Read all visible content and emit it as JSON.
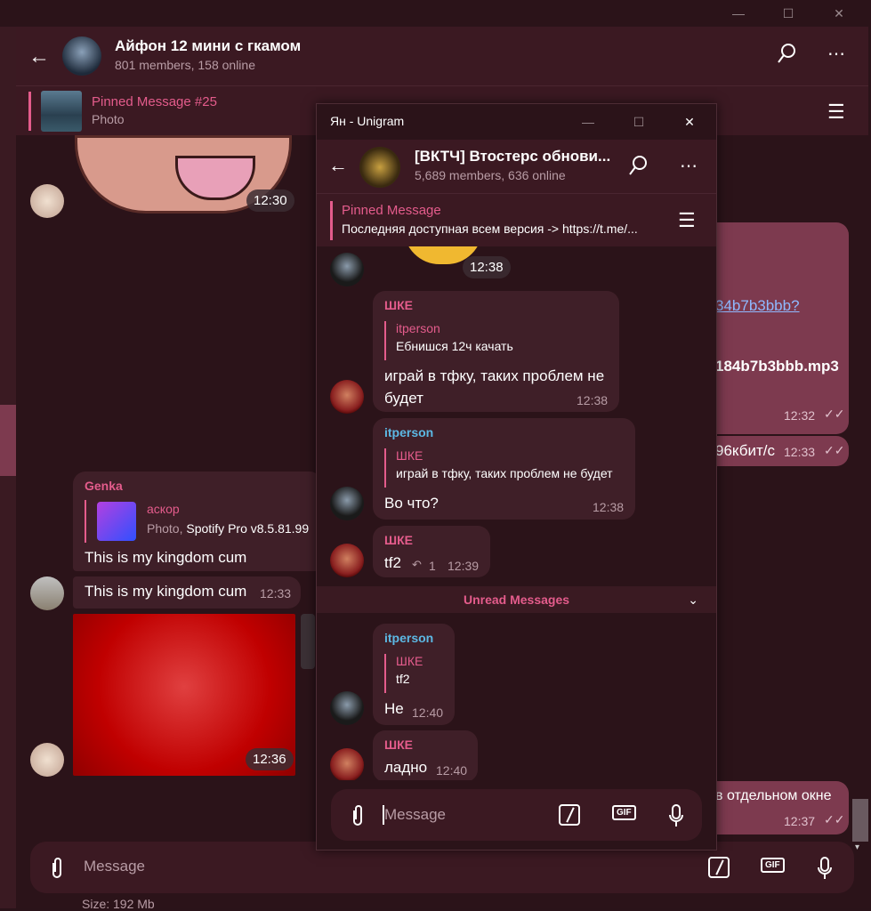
{
  "main": {
    "header": {
      "title": "Айфон 12 мини с гкамом",
      "subtitle": "801 members, 158 online"
    },
    "pinned": {
      "title": "Pinned Message #25",
      "subtitle": "Photo"
    },
    "messages": {
      "sticker_time": "12:30",
      "own1_link": "34b7b3bbb?",
      "own1_file": "184b7b3bbb.mp3",
      "own1_time": "12:32",
      "own2_text": "96кбит/с",
      "own2_time": "12:33",
      "genka_name": "Genka",
      "genka_reply_name": "аскор",
      "genka_reply_prefix": "Photo,",
      "genka_reply_text": "Spotify Pro  v8.5.81.99",
      "genka_text": "This is my kingdom cum",
      "genka2_text": "This is my kingdom cum",
      "genka2_time": "12:33",
      "photo_time": "12:36",
      "own3_text": "в отдельном окне",
      "own3_time": "12:37",
      "bottom_cut_text": "Size:   192 Mb"
    },
    "composer": {
      "placeholder": "Message"
    }
  },
  "popup": {
    "title": "Ян - Unigram",
    "header": {
      "title": "[ВКТЧ] Втостерс обнови...",
      "subtitle": "5,689 members, 636 online"
    },
    "pinned": {
      "title": "Pinned Message",
      "text": "Последняя доступная всем версия -> https://t.me/..."
    },
    "messages": {
      "sticker_time": "12:38",
      "m1_name": "ШКЕ",
      "m1_reply_name": "itperson",
      "m1_reply_text": "Ебнишся 12ч качать",
      "m1_text_line1": "играй в тфку, таких проблем не",
      "m1_text_line2": "будет",
      "m1_time": "12:38",
      "m2_name": "itperson",
      "m2_reply_name": "ШКЕ",
      "m2_reply_text": "играй в тфку, таких проблем не будет",
      "m2_text": "Во что?",
      "m2_time": "12:38",
      "m3_name": "ШКЕ",
      "m3_text": "tf2",
      "m3_replies": "1",
      "m3_time": "12:39",
      "unread": "Unread Messages",
      "m4_name": "itperson",
      "m4_reply_name": "ШКЕ",
      "m4_reply_text": "tf2",
      "m4_text": "Не",
      "m4_time": "12:40",
      "m5_name": "ШКЕ",
      "m5_text": "ладно",
      "m5_time": "12:40"
    },
    "composer": {
      "placeholder": "Message"
    }
  },
  "icons": {
    "gif": "GIF"
  },
  "colors": {
    "accent": "#e45c8c",
    "bg": "#2b1319",
    "panel": "#3b1922",
    "own_bubble": "#7d3a4f",
    "link": "#8fb9ff"
  }
}
